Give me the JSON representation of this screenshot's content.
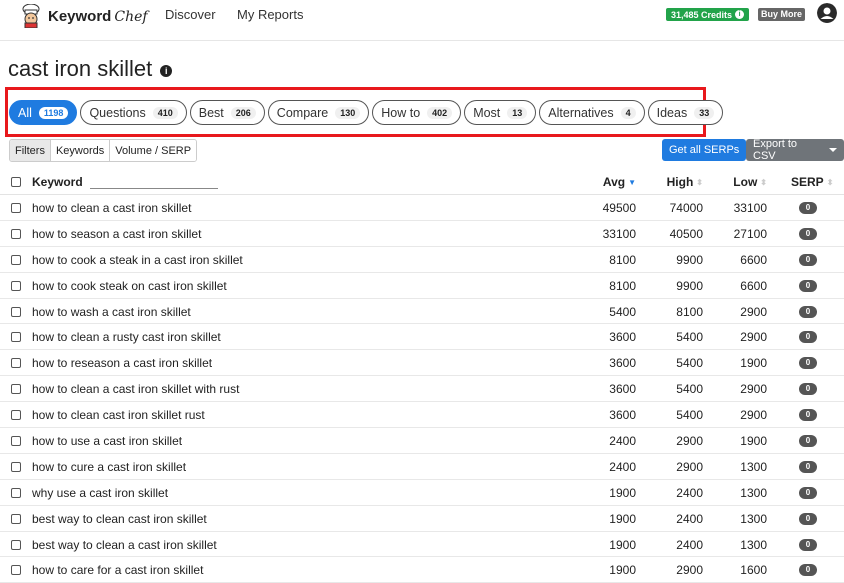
{
  "header": {
    "brand": "Keyword",
    "brand_script": "Chef",
    "nav": [
      "Discover",
      "My Reports"
    ],
    "credits": "31,485 Credits",
    "buy_more": "Buy More"
  },
  "page_title": "cast iron skillet",
  "tabs": [
    {
      "label": "All",
      "count": "1198",
      "active": true
    },
    {
      "label": "Questions",
      "count": "410"
    },
    {
      "label": "Best",
      "count": "206"
    },
    {
      "label": "Compare",
      "count": "130"
    },
    {
      "label": "How to",
      "count": "402"
    },
    {
      "label": "Most",
      "count": "13"
    },
    {
      "label": "Alternatives",
      "count": "4"
    },
    {
      "label": "Ideas",
      "count": "33"
    }
  ],
  "filters": [
    "Filters",
    "Keywords",
    "Volume / SERP"
  ],
  "actions": {
    "get_all": "Get all SERPs",
    "export": "Export to CSV"
  },
  "table": {
    "headers": {
      "keyword": "Keyword",
      "avg": "Avg",
      "high": "High",
      "low": "Low",
      "serp": "SERP"
    },
    "rows": [
      {
        "keyword": "how to clean a cast iron skillet",
        "avg": "49500",
        "high": "74000",
        "low": "33100",
        "serp": "0"
      },
      {
        "keyword": "how to season a cast iron skillet",
        "avg": "33100",
        "high": "40500",
        "low": "27100",
        "serp": "0"
      },
      {
        "keyword": "how to cook a steak in a cast iron skillet",
        "avg": "8100",
        "high": "9900",
        "low": "6600",
        "serp": "0"
      },
      {
        "keyword": "how to cook steak on cast iron skillet",
        "avg": "8100",
        "high": "9900",
        "low": "6600",
        "serp": "0"
      },
      {
        "keyword": "how to wash a cast iron skillet",
        "avg": "5400",
        "high": "8100",
        "low": "2900",
        "serp": "0"
      },
      {
        "keyword": "how to clean a rusty cast iron skillet",
        "avg": "3600",
        "high": "5400",
        "low": "2900",
        "serp": "0"
      },
      {
        "keyword": "how to reseason a cast iron skillet",
        "avg": "3600",
        "high": "5400",
        "low": "1900",
        "serp": "0"
      },
      {
        "keyword": "how to clean a cast iron skillet with rust",
        "avg": "3600",
        "high": "5400",
        "low": "2900",
        "serp": "0"
      },
      {
        "keyword": "how to clean cast iron skillet rust",
        "avg": "3600",
        "high": "5400",
        "low": "2900",
        "serp": "0"
      },
      {
        "keyword": "how to use a cast iron skillet",
        "avg": "2400",
        "high": "2900",
        "low": "1900",
        "serp": "0"
      },
      {
        "keyword": "how to cure a cast iron skillet",
        "avg": "2400",
        "high": "2900",
        "low": "1300",
        "serp": "0"
      },
      {
        "keyword": "why use a cast iron skillet",
        "avg": "1900",
        "high": "2400",
        "low": "1300",
        "serp": "0"
      },
      {
        "keyword": "best way to clean cast iron skillet",
        "avg": "1900",
        "high": "2400",
        "low": "1300",
        "serp": "0"
      },
      {
        "keyword": "best way to clean a cast iron skillet",
        "avg": "1900",
        "high": "2400",
        "low": "1300",
        "serp": "0"
      },
      {
        "keyword": "how to care for a cast iron skillet",
        "avg": "1900",
        "high": "2900",
        "low": "1600",
        "serp": "0"
      }
    ]
  },
  "colors": {
    "accent": "#1f7be0",
    "credits": "#22a34a",
    "highlight": "#e8181c"
  }
}
